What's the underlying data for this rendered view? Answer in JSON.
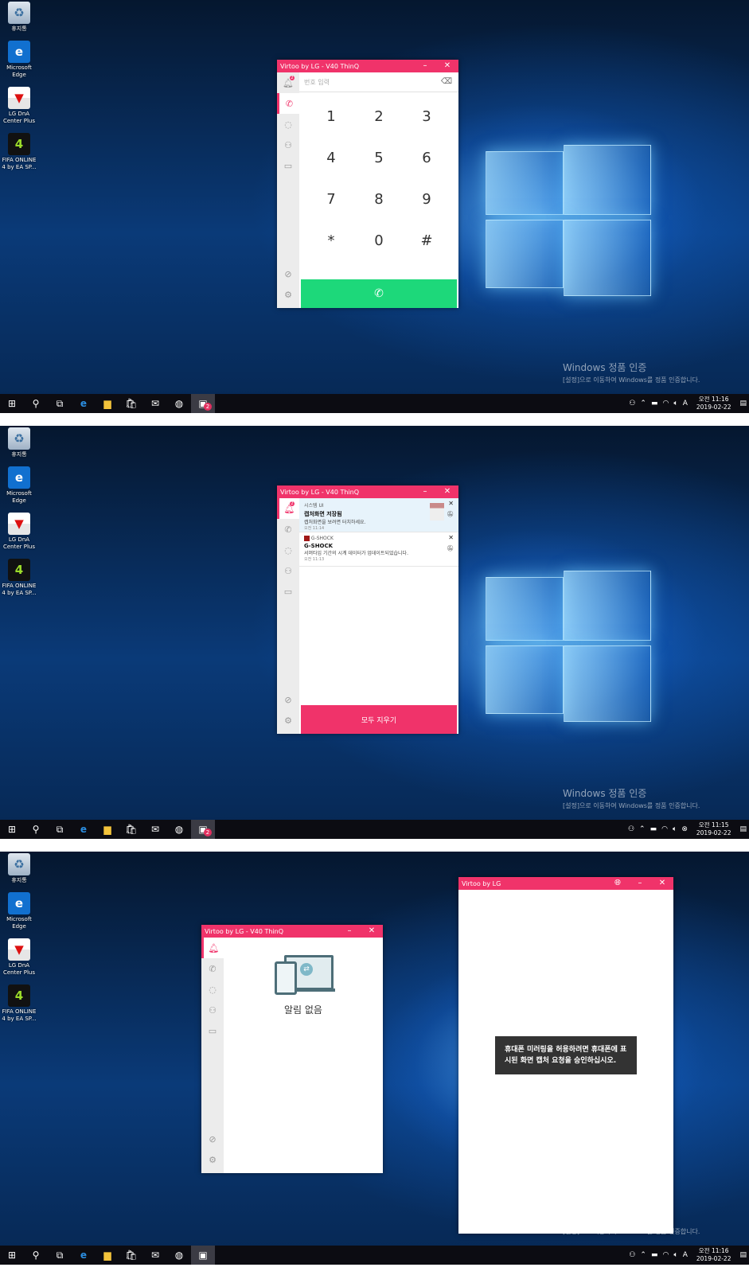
{
  "desktop": {
    "icons": [
      {
        "label": "휴지통",
        "icon": "recycle-bin-icon",
        "glyph": "♻"
      },
      {
        "label": "Microsoft Edge",
        "icon": "edge-icon",
        "glyph": "e"
      },
      {
        "label": "LG DnA Center Plus",
        "icon": "lg-dna-icon",
        "glyph": "▼"
      },
      {
        "label": "FIFA ONLINE 4 by EA SP...",
        "icon": "fifa-online-icon",
        "glyph": "4"
      }
    ],
    "activation_title": "Windows 정품 인증",
    "activation_sub": "[설정]으로 이동하여 Windows를 정품 인증합니다."
  },
  "taskbar": {
    "badge": "2",
    "ime": "A",
    "screens": [
      {
        "time": "오전 11:16",
        "date": "2019-02-22"
      },
      {
        "time": "오전 11:15",
        "date": "2019-02-22"
      },
      {
        "time": "오전 11:16",
        "date": "2019-02-22"
      }
    ]
  },
  "app": {
    "title": "Virtoo by LG - V40 ThinQ",
    "notif_count": "2",
    "accent": "#f0336a",
    "call_color": "#1dd87a"
  },
  "dialer": {
    "placeholder": "번호 입력",
    "keys": [
      "1",
      "2",
      "3",
      "4",
      "5",
      "6",
      "7",
      "8",
      "9",
      "*",
      "0",
      "#"
    ]
  },
  "notifications": {
    "items": [
      {
        "app": "시스템 UI",
        "title": "캡처화면 저장됨",
        "text": "캡처화면을 보려면 터치하세요.",
        "time": "오전 11:14"
      },
      {
        "app": "G-SHOCK",
        "title": "G-SHOCK",
        "text": "서머타임 기간의 시계 데이터가 업데이트되었습니다.",
        "time": "오전 11:13"
      }
    ],
    "clear_all": "모두 지우기",
    "empty": "알림 없음"
  },
  "mirror": {
    "title": "Virtoo by LG",
    "message": "휴대폰 미러링을 허용하려면 휴대폰에 표시된 화면 캡처 요청을 승인하십시오."
  }
}
